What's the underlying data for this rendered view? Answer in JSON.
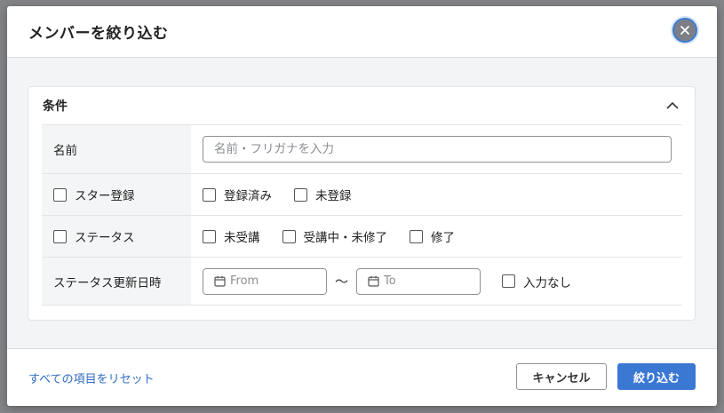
{
  "modal": {
    "title": "メンバーを絞り込む",
    "close_icon": "close-icon"
  },
  "conditions": {
    "title": "条件",
    "collapse_icon": "chevron-up-icon",
    "name_row": {
      "label": "名前",
      "placeholder": "名前・フリガナを入力",
      "value": ""
    },
    "star_row": {
      "label": "スター登録",
      "options": [
        "登録済み",
        "未登録"
      ]
    },
    "status_row": {
      "label": "ステータス",
      "options": [
        "未受講",
        "受講中・未修了",
        "修了"
      ]
    },
    "date_row": {
      "label": "ステータス更新日時",
      "from_placeholder": "From",
      "to_placeholder": "To",
      "separator": "～",
      "no_input_label": "入力なし",
      "calendar_icon": "calendar-icon"
    }
  },
  "footer": {
    "reset_label": "すべての項目をリセット",
    "cancel_label": "キャンセル",
    "submit_label": "絞り込む"
  },
  "colors": {
    "accent": "#3b78d4",
    "link": "#2f6cc2",
    "close_button": "#7c7f86"
  }
}
